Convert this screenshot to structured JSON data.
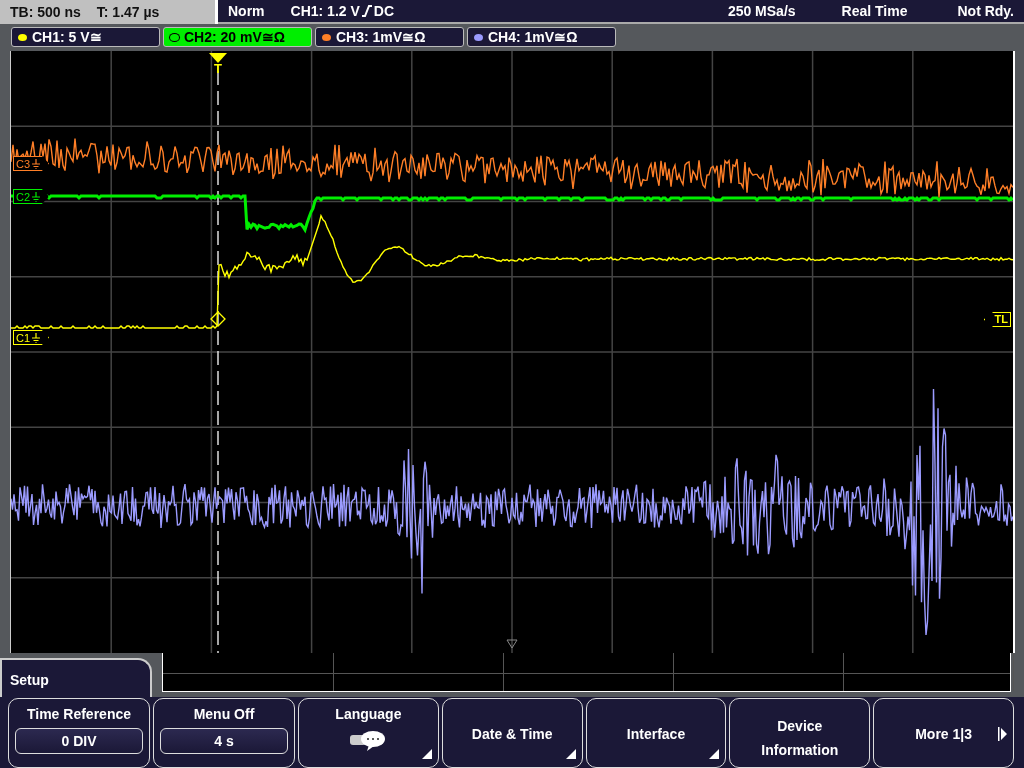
{
  "status_bar": {
    "timebase": "TB: 500 ns",
    "trigger_time": "T: 1.47 µs",
    "trigger_mode": "Norm",
    "trigger_source": "CH1: 1.2 V",
    "trigger_coupling": "DC",
    "sample_rate": "250 MSa/s",
    "acquisition": "Real Time",
    "state": "Not Rdy."
  },
  "channels": [
    {
      "label": "CH1: 5 V≅",
      "selected": false,
      "color": "#ffff00"
    },
    {
      "label": "CH2: 20 mV≅Ω",
      "selected": true,
      "color": "#00ee00"
    },
    {
      "label": "CH3: 1mV≅Ω",
      "selected": false,
      "color": "#ff7f27"
    },
    {
      "label": "CH4: 1mV≅Ω",
      "selected": false,
      "color": "#9b9bff"
    }
  ],
  "markers": [
    {
      "label": "C3",
      "color": "#ff7f27"
    },
    {
      "label": "C2",
      "color": "#00ee00"
    },
    {
      "label": "C1",
      "color": "#ffff00"
    }
  ],
  "trigger_marker": "T",
  "trigger_level_marker": "TL",
  "menu": {
    "title": "Setup",
    "softkeys": [
      {
        "label": "Time Reference",
        "value": "0 DIV",
        "kind": "value"
      },
      {
        "label": "Menu Off",
        "value": "4 s",
        "kind": "value"
      },
      {
        "label": "Language",
        "kind": "icon-menu"
      },
      {
        "label": "Date & Time",
        "kind": "menu"
      },
      {
        "label": "Interface",
        "kind": "menu"
      },
      {
        "label": "Device Information",
        "kind": "plain"
      },
      {
        "label": "More 1|3",
        "kind": "next"
      }
    ]
  }
}
